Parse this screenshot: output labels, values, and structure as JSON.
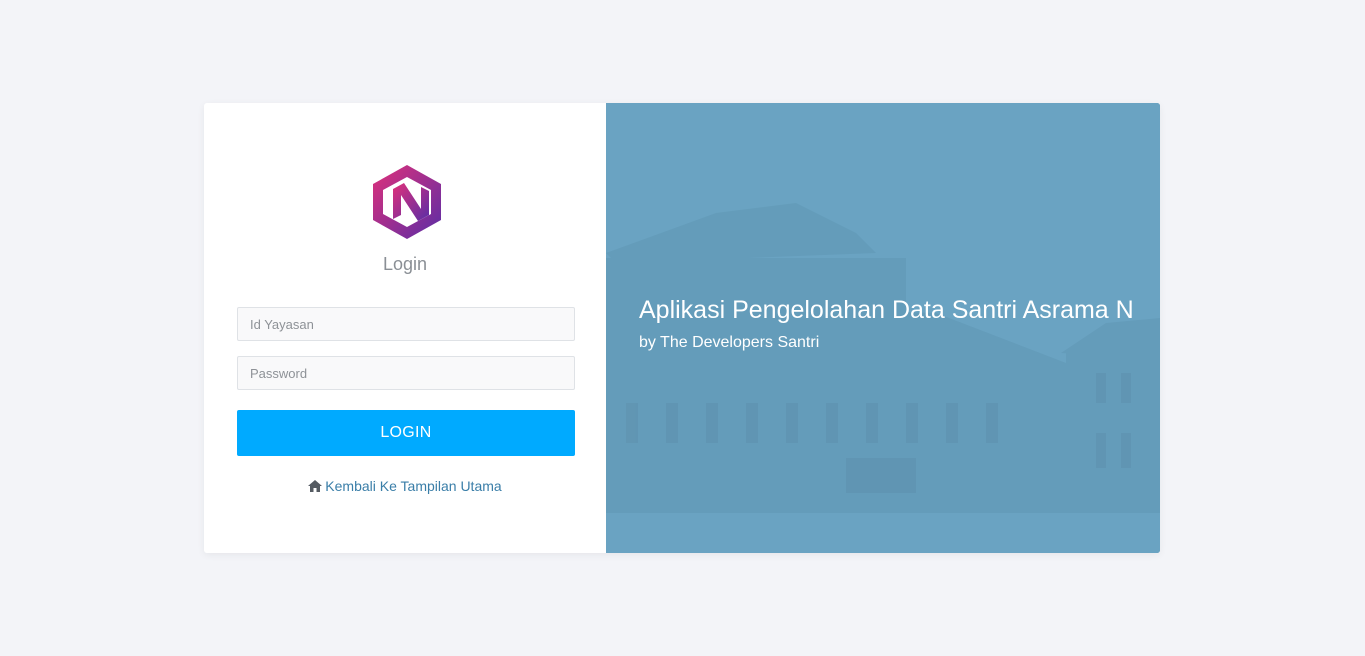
{
  "login_panel": {
    "logo_icon": "hexagon-n-logo-icon",
    "heading": "Login",
    "id_field": {
      "placeholder": "Id Yayasan",
      "value": ""
    },
    "password_field": {
      "placeholder": "Password",
      "value": ""
    },
    "login_button_label": "LOGIN",
    "back_link": {
      "icon": "home-icon",
      "label": "Kembali Ke Tampilan Utama"
    }
  },
  "hero_panel": {
    "title": "Aplikasi Pengelolahan Data Santri Asrama N",
    "subtitle": "by The Developers Santri"
  },
  "colors": {
    "page_background": "#f3f4f8",
    "button_blue": "#00aaff",
    "link_blue": "#3a7ea8",
    "hero_overlay": "#6aa3c2",
    "logo_gradient_start": "#e0307a",
    "logo_gradient_end": "#5a2ea6"
  }
}
